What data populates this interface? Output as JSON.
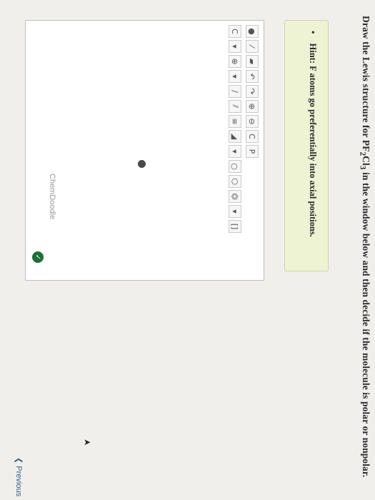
{
  "question": {
    "text_before": "Draw the Lewis structure for PF",
    "sub1": "2",
    "text_mid": "Cl",
    "sub2": "3",
    "text_after": " in the window below and then decide if the molecule is polar or nonpolar."
  },
  "hint": {
    "bullet": "•",
    "text": "Hint: F atoms go preferentially into axial positions."
  },
  "toolbar": {
    "row1": [
      {
        "icon": "atom-color-icon",
        "glyph": "●"
      },
      {
        "icon": "bond-icon",
        "glyph": "⁄"
      },
      {
        "icon": "wedge-icon",
        "glyph": "▰"
      },
      {
        "icon": "undo-icon",
        "glyph": "↶"
      },
      {
        "icon": "redo-icon",
        "glyph": "↷"
      },
      {
        "icon": "zoom-in-icon",
        "glyph": "⊕"
      },
      {
        "icon": "zoom-out-icon",
        "glyph": "⊖"
      },
      {
        "icon": "text-c-icon",
        "glyph": "C"
      },
      {
        "icon": "text-p-icon",
        "glyph": "P"
      }
    ],
    "row2": [
      {
        "icon": "carbon-icon",
        "glyph": "C"
      },
      {
        "icon": "dropdown-icon",
        "glyph": "▾"
      },
      {
        "icon": "charge-icon",
        "glyph": "⊕"
      },
      {
        "icon": "dropdown-icon",
        "glyph": "▾"
      },
      {
        "icon": "single-bond-icon",
        "glyph": "/"
      },
      {
        "icon": "double-bond-icon",
        "glyph": "⫽"
      },
      {
        "icon": "triple-bond-icon",
        "glyph": "≡"
      },
      {
        "icon": "wedge-bond-icon",
        "glyph": "◢"
      },
      {
        "icon": "dropdown-icon",
        "glyph": "▾"
      },
      {
        "icon": "ring-icon",
        "glyph": "○"
      },
      {
        "icon": "hexagon-icon",
        "glyph": "⬡"
      },
      {
        "icon": "benzene-icon",
        "glyph": "⏣"
      },
      {
        "icon": "dropdown-icon",
        "glyph": "▾"
      },
      {
        "icon": "bracket-icon",
        "glyph": "[]"
      }
    ]
  },
  "watermark": "ChemDoodle",
  "check_label": "✓",
  "previous_label": "Previous",
  "previous_chevron": "❮"
}
